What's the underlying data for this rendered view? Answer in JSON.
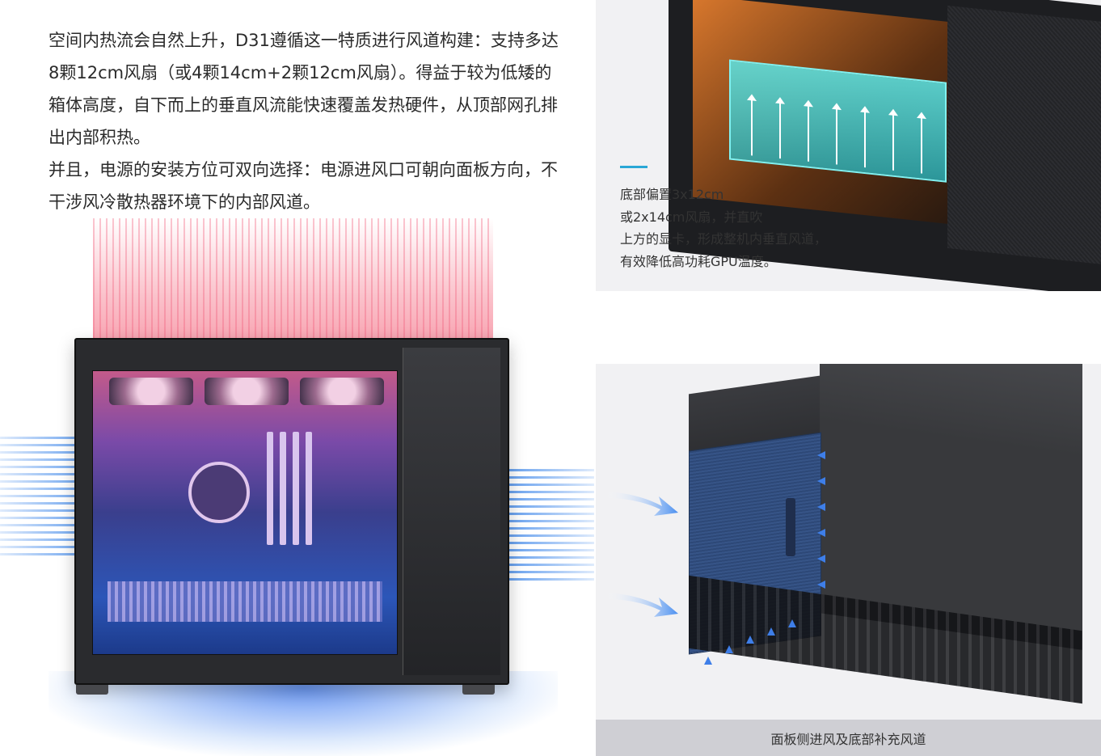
{
  "intro": {
    "paragraph1": "空间内热流会自然上升，D31遵循这一特质进行风道构建：支持多达8颗12cm风扇（或4颗14cm+2颗12cm风扇）。得益于较为低矮的箱体高度，自下而上的垂直风流能快速覆盖发热硬件，从顶部网孔排出内部积热。",
    "paragraph2": "并且，电源的安装方位可双向选择：电源进风口可朝向面板方向，不干涉风冷散热器环境下的内部风道。"
  },
  "top_card": {
    "caption_lines": [
      "底部偏置3x12cm",
      "或2x14cm风扇，并直吹",
      "上方的显卡，形成整机内垂直风道，",
      "有效降低高功耗GPU温度。"
    ],
    "accent_color": "#2aa7d6"
  },
  "bottom_card": {
    "caption": "面板侧进风及底部补充风道"
  },
  "colors": {
    "hot_air": "#f05a78",
    "cool_air": "#3e7ee8",
    "case_body": "#2a2b2e"
  }
}
